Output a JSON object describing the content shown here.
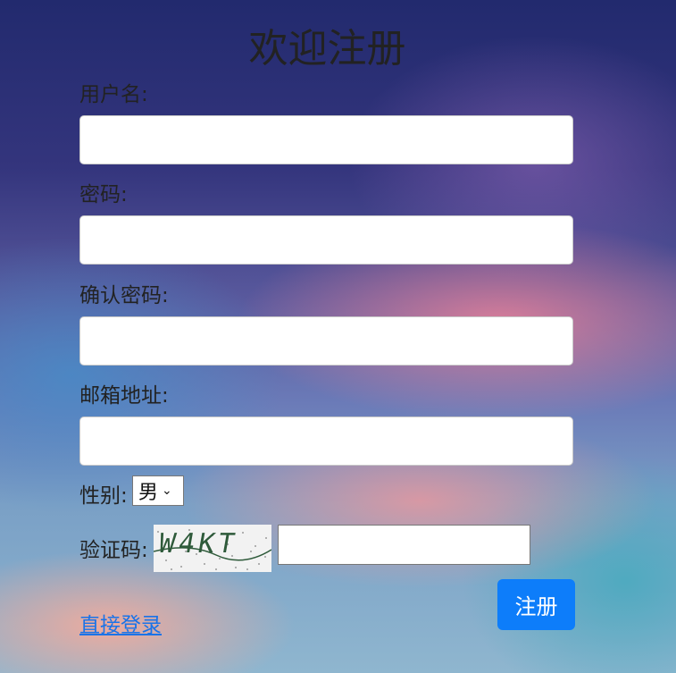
{
  "page": {
    "title": "欢迎注册"
  },
  "form": {
    "username_label": "用户名:",
    "password_label": "密码:",
    "confirm_password_label": "确认密码:",
    "email_label": "邮箱地址:",
    "gender_label": "性别:",
    "gender_selected": "男",
    "captcha_label": "验证码:",
    "captcha_image_text": "W4KT",
    "submit_label": "注册",
    "login_link": "直接登录"
  },
  "colors": {
    "primary_button": "#0d7dfa",
    "link": "#1a73e8"
  }
}
